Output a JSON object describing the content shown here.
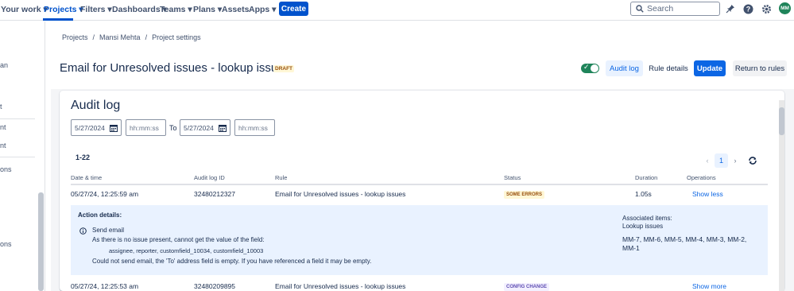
{
  "nav": {
    "items": [
      "Your work",
      "Projects",
      "Filters",
      "Dashboards",
      "Teams",
      "Plans",
      "Assets",
      "Apps"
    ],
    "create": "Create",
    "search_placeholder": "Search",
    "avatar_initials": "MM",
    "accent": "#0052cc"
  },
  "sidebar": {
    "items": [
      "an",
      "t",
      "nt",
      "nt",
      "ons",
      "ons"
    ]
  },
  "breadcrumb": [
    "Projects",
    "/",
    "Mansi Mehta",
    "/",
    "Project settings"
  ],
  "header": {
    "title": "Email for Unresolved issues - lookup issues",
    "badge": "DRAFT",
    "toggle_on": true,
    "audit_log": "Audit log",
    "rule_details": "Rule details",
    "update": "Update",
    "return": "Return to rules"
  },
  "audit": {
    "title": "Audit log",
    "from_date": "5/27/2024",
    "from_time_placeholder": "hh:mm:ss",
    "to_label": "To",
    "to_date": "5/27/2024",
    "to_time_placeholder": "hh:mm:ss",
    "count": "1-22",
    "current_page": "1"
  },
  "table": {
    "columns": [
      "Date & time",
      "Audit log ID",
      "Rule",
      "Status",
      "Duration",
      "Operations"
    ],
    "rows": [
      {
        "date": "05/27/24, 12:25:59 am",
        "id": "32480212327",
        "rule": "Email for Unresolved issues - lookup issues",
        "status": "SOME ERRORS",
        "duration": "1.05s",
        "operation": "Show less"
      },
      {
        "date": "05/27/24, 12:25:53 am",
        "id": "32480209895",
        "rule": "Email for Unresolved issues - lookup issues",
        "status": "CONFIG CHANGE",
        "duration": "",
        "operation": "Show more"
      }
    ]
  },
  "details": {
    "heading": "Action details:",
    "action": "Send email",
    "line1": "As there is no issue present, cannot get the value of the field:",
    "line2": "assignee, reporter, customfield_10034, customfield_10003",
    "line3": "Could not send email, the 'To' address field is empty. If you have referenced a field it may be empty.",
    "assoc_heading": "Associated items:",
    "assoc_sub": "Lookup issues",
    "assoc_line1": "MM-7, MM-6, MM-5, MM-4, MM-3, MM-2,",
    "assoc_line2": "MM-1"
  }
}
